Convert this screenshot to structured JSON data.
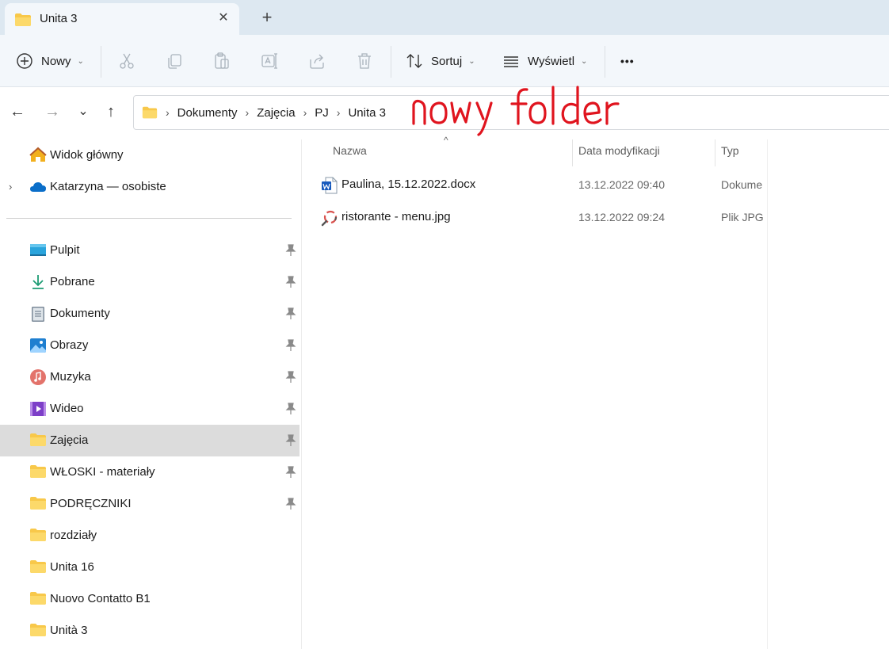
{
  "window": {
    "tab_title": "Unita 3",
    "close_glyph": "✕",
    "new_tab_glyph": "+"
  },
  "toolbar": {
    "new_label": "Nowy",
    "sort_label": "Sortuj",
    "view_label": "Wyświetl",
    "more_glyph": "•••",
    "chevron": "⌄"
  },
  "nav": {
    "back": "←",
    "forward": "→",
    "recent": "⌄",
    "up": "↑"
  },
  "address": {
    "separator": "›",
    "crumbs": [
      "Dokumenty",
      "Zajęcia",
      "PJ",
      "Unita 3"
    ]
  },
  "annotation": {
    "text": "nowy folder",
    "color": "#e0141e"
  },
  "sidebar": {
    "expand_glyph": "›",
    "top": [
      {
        "label": "Widok główny",
        "icon": "home-icon"
      },
      {
        "label": "Katarzyna — osobiste",
        "icon": "onedrive-cloud-icon"
      }
    ],
    "pinned": [
      {
        "label": "Pulpit",
        "icon": "desktop-icon",
        "pinned": true
      },
      {
        "label": "Pobrane",
        "icon": "download-icon",
        "pinned": true
      },
      {
        "label": "Dokumenty",
        "icon": "documents-icon",
        "pinned": true
      },
      {
        "label": "Obrazy",
        "icon": "pictures-icon",
        "pinned": true
      },
      {
        "label": "Muzyka",
        "icon": "music-icon",
        "pinned": true
      },
      {
        "label": "Wideo",
        "icon": "video-icon",
        "pinned": true
      },
      {
        "label": "Zajęcia",
        "icon": "folder-icon",
        "pinned": true,
        "selected": true
      },
      {
        "label": "WŁOSKI - materiały",
        "icon": "folder-icon",
        "pinned": true
      },
      {
        "label": "PODRĘCZNIKI",
        "icon": "folder-icon",
        "pinned": true
      },
      {
        "label": "rozdziały",
        "icon": "folder-icon",
        "pinned": false
      },
      {
        "label": "Unita 16",
        "icon": "folder-icon",
        "pinned": false
      },
      {
        "label": "Nuovo Contatto B1",
        "icon": "folder-icon",
        "pinned": false
      },
      {
        "label": "Unità 3",
        "icon": "folder-icon",
        "pinned": false
      }
    ]
  },
  "file_list": {
    "sort_glyph": "^",
    "columns": {
      "name": "Nazwa",
      "date": "Data modyfikacji",
      "type": "Typ"
    },
    "rows": [
      {
        "name": "Paulina, 15.12.2022.docx",
        "date": "13.12.2022 09:40",
        "type": "Dokume",
        "icon": "word-document-icon"
      },
      {
        "name": "ristorante - menu.jpg",
        "date": "13.12.2022 09:24",
        "type": "Plik JPG",
        "icon": "image-viewer-icon"
      }
    ]
  },
  "colors": {
    "titlebar": "#dde8f1",
    "toolbar": "#f3f7fb",
    "selected_row": "#dcdcdc",
    "folder_yellow": "#f8c84a",
    "accent_blue": "#0a6ec9"
  }
}
